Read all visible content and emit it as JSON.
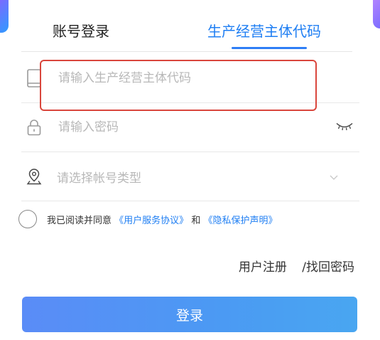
{
  "tabs": {
    "account_login": "账号登录",
    "entity_code": "生产经营主体代码"
  },
  "form": {
    "code_placeholder": "请输入生产经营主体代码",
    "password_placeholder": "请输入密码",
    "account_type_placeholder": "请选择帐号类型"
  },
  "agreement": {
    "prefix": "我已阅读并同意",
    "user_service": "《用户服务协议》",
    "and": "和",
    "privacy": "《隐私保护声明》"
  },
  "links": {
    "register": "用户注册",
    "retrieve_password": "/找回密码"
  },
  "buttons": {
    "login": "登录"
  },
  "icons": {
    "code_field": "tablet-icon",
    "password_field": "lock-icon",
    "type_field": "location-pin-icon",
    "password_toggle": "eye-closed-icon",
    "dropdown": "chevron-down-icon"
  },
  "colors": {
    "accent": "#1e7ef3",
    "highlight": "#d9463c"
  }
}
